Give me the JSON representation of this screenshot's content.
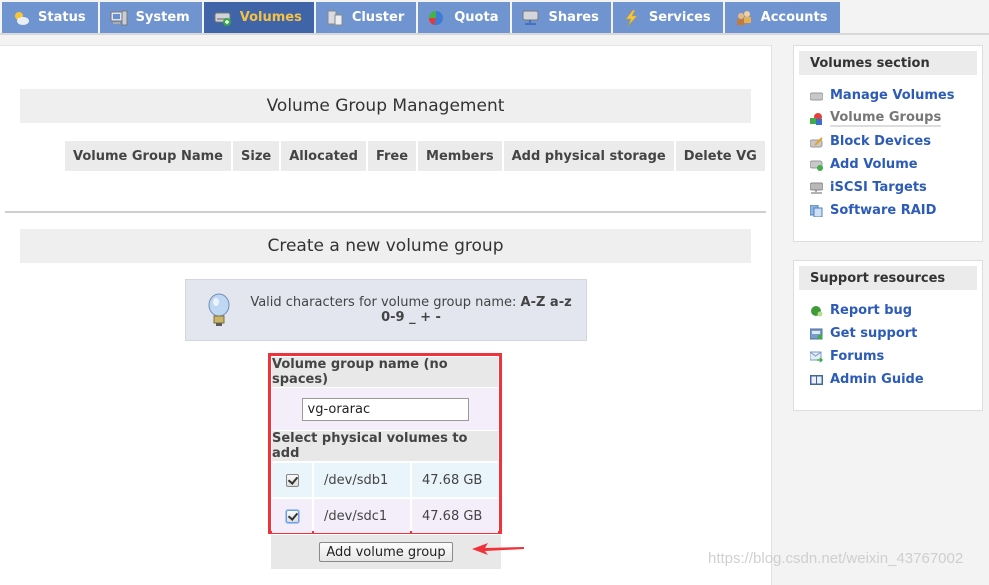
{
  "tabs": [
    {
      "label": "Status",
      "icon": "weather-icon",
      "active": false
    },
    {
      "label": "System",
      "icon": "computer-icon",
      "active": false
    },
    {
      "label": "Volumes",
      "icon": "disk-icon",
      "active": true
    },
    {
      "label": "Cluster",
      "icon": "cluster-icon",
      "active": false
    },
    {
      "label": "Quota",
      "icon": "pie-icon",
      "active": false
    },
    {
      "label": "Shares",
      "icon": "share-icon",
      "active": false
    },
    {
      "label": "Services",
      "icon": "lightning-icon",
      "active": false
    },
    {
      "label": "Accounts",
      "icon": "users-icon",
      "active": false
    }
  ],
  "main": {
    "vg_management": {
      "title": "Volume Group Management",
      "columns": [
        "Volume Group Name",
        "Size",
        "Allocated",
        "Free",
        "Members",
        "Add physical storage",
        "Delete VG"
      ]
    },
    "create": {
      "title": "Create a new volume group",
      "hint_prefix": "Valid characters for volume group name: ",
      "hint_chars": "A-Z a-z 0-9 _ + -",
      "name_label": "Volume group name (no spaces)",
      "name_value": "vg-orarac",
      "pv_label": "Select physical volumes to add",
      "physical_volumes": [
        {
          "device": "/dev/sdb1",
          "size": "47.68 GB",
          "checked": true
        },
        {
          "device": "/dev/sdc1",
          "size": "47.68 GB",
          "checked": true
        }
      ],
      "submit_label": "Add volume group"
    }
  },
  "sidebar": {
    "volumes_section": {
      "title": "Volumes section",
      "items": [
        {
          "label": "Manage Volumes",
          "icon": "drive-icon"
        },
        {
          "label": "Volume Groups",
          "icon": "cubes-icon",
          "current": true
        },
        {
          "label": "Block Devices",
          "icon": "drive-edit-icon"
        },
        {
          "label": "Add Volume",
          "icon": "drive-add-icon"
        },
        {
          "label": "iSCSI Targets",
          "icon": "network-drive-icon"
        },
        {
          "label": "Software RAID",
          "icon": "raid-icon"
        }
      ]
    },
    "support": {
      "title": "Support resources",
      "items": [
        {
          "label": "Report bug",
          "icon": "bug-icon"
        },
        {
          "label": "Get support",
          "icon": "support-icon"
        },
        {
          "label": "Forums",
          "icon": "mail-forward-icon"
        },
        {
          "label": "Admin Guide",
          "icon": "book-icon"
        }
      ]
    }
  },
  "watermark": "https://blog.csdn.net/weixin_43767002",
  "colors": {
    "tab": "#7094d0",
    "tab_active": "#3f64a8",
    "tab_active_text": "#f5c246",
    "link": "#2c5bb8",
    "highlight_box": "#f0333a"
  }
}
